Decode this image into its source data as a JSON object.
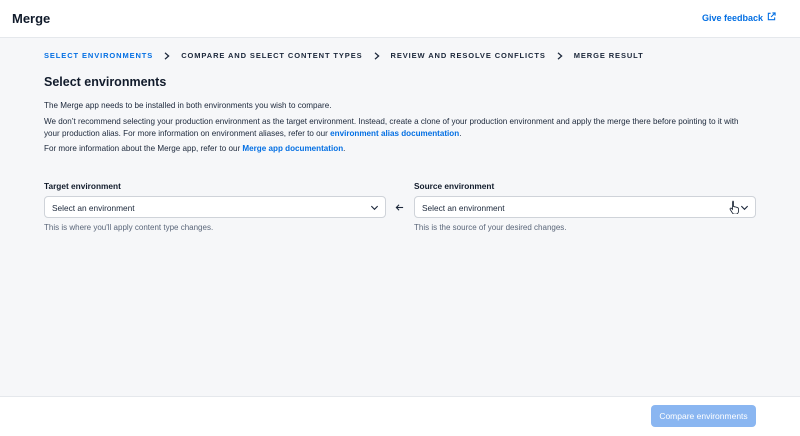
{
  "header": {
    "title": "Merge",
    "feedback_label": "Give feedback",
    "feedback_icon": "external-link-icon"
  },
  "stepper": {
    "steps": [
      {
        "label": "SELECT ENVIRONMENTS",
        "active": true
      },
      {
        "label": "COMPARE AND SELECT CONTENT TYPES",
        "active": false
      },
      {
        "label": "REVIEW AND RESOLVE CONFLICTS",
        "active": false
      },
      {
        "label": "MERGE RESULT",
        "active": false
      }
    ]
  },
  "main": {
    "title": "Select environments",
    "intro": "The Merge app needs to be installed in both environments you wish to compare.",
    "recommendation_line1": "We don’t recommend selecting your production environment as the target environment. Instead, create a clone of your production environment and apply the merge there before pointing to it with",
    "recommendation_line2": "your production alias. For more information on environment aliases, refer to our",
    "alias_link": "environment alias documentation",
    "info_text": "For more information about the Merge app, refer to our",
    "app_link": "Merge app documentation"
  },
  "target": {
    "label": "Target environment",
    "value": "Select an environment",
    "help": "This is where you'll apply content type changes."
  },
  "source": {
    "label": "Source environment",
    "value": "Select an environment",
    "help": "This is the source of your desired changes."
  },
  "footer": {
    "compare_label": "Compare environments"
  },
  "colors": {
    "accent": "#036fe3",
    "button_disabled": "#8ab6f1",
    "background": "#f6f7f9"
  }
}
